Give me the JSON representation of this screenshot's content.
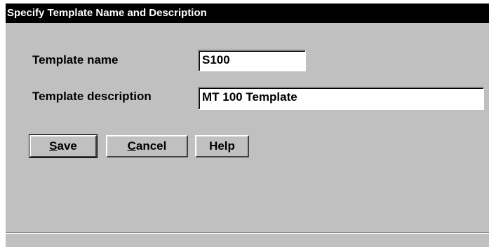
{
  "dialog": {
    "title": "Specify Template Name and Description"
  },
  "form": {
    "name_label": "Template name",
    "name_value": "S100",
    "description_label": "Template description",
    "description_value": "MT 100 Template"
  },
  "buttons": {
    "save": {
      "mnemonic": "S",
      "rest": "ave"
    },
    "cancel": {
      "mnemonic": "C",
      "rest": "ancel"
    },
    "help": {
      "label": "Help"
    }
  }
}
